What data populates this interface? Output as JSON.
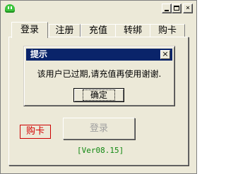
{
  "window": {
    "controls": {
      "minimize": "_",
      "maximize": "□",
      "close": "×"
    }
  },
  "tabs": [
    {
      "label": "登录",
      "active": true
    },
    {
      "label": "注册",
      "active": false
    },
    {
      "label": "充值",
      "active": false
    },
    {
      "label": "转绑",
      "active": false
    },
    {
      "label": "购卡",
      "active": false
    }
  ],
  "dialog": {
    "title": "提示",
    "close": "×",
    "message": "该用户已过期,请充值再使用谢谢.",
    "ok_label": "确定"
  },
  "buttons": {
    "buy_card": "购卡",
    "login": "登录"
  },
  "version": "[Ver08.15]",
  "colors": {
    "window_bg": "#ece9d8",
    "dialog_title_bg": "#0a246a",
    "buy_card_text": "#d40000",
    "version_text": "#118811"
  }
}
